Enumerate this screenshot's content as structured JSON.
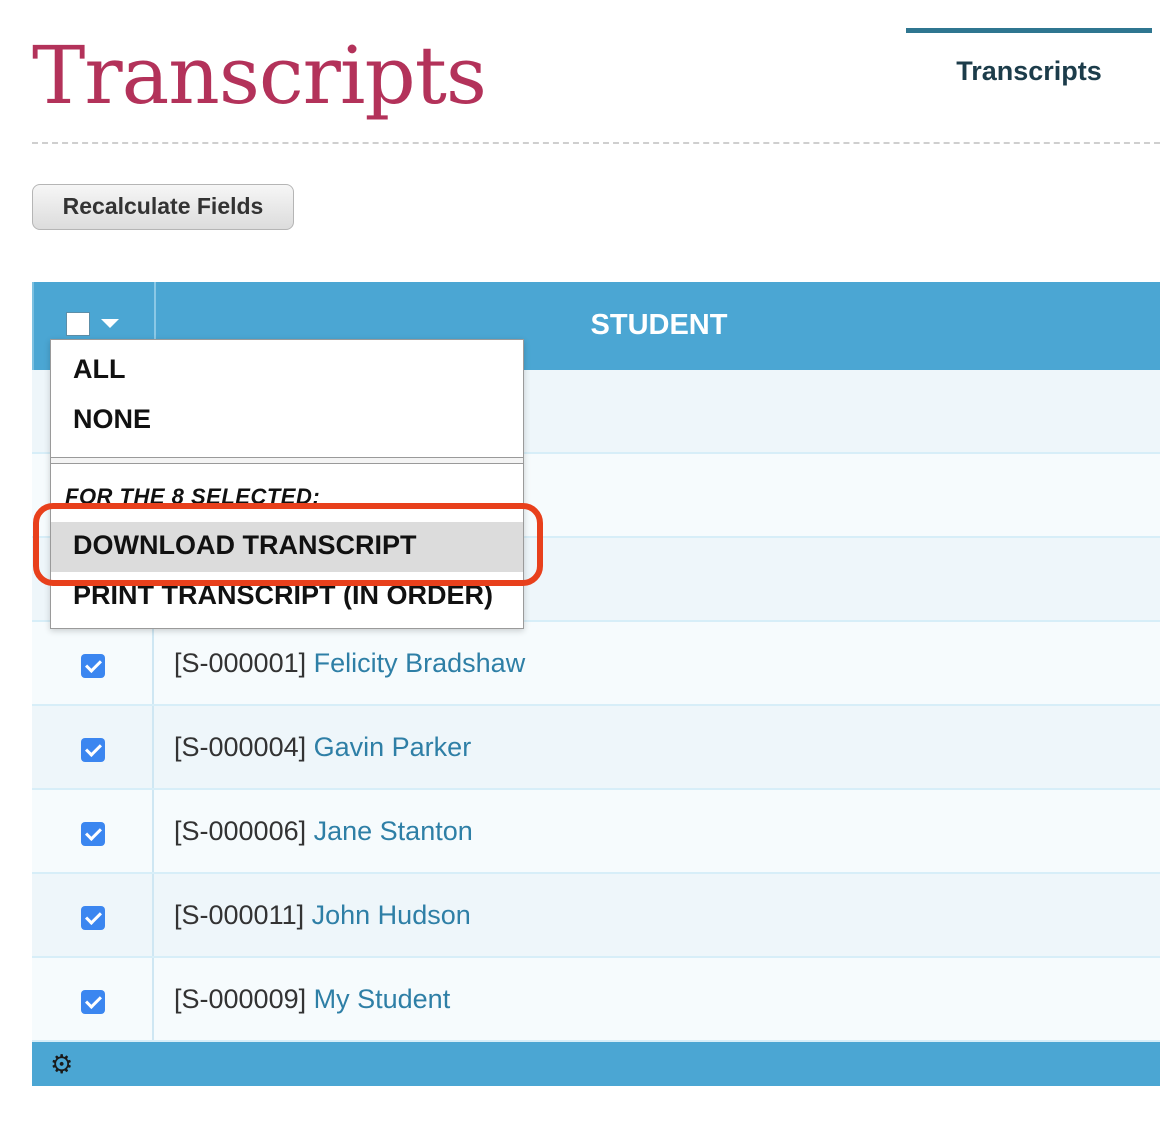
{
  "header": {
    "title": "Transcripts",
    "tab_label": "Transcripts"
  },
  "toolbar": {
    "recalculate_label": "Recalculate Fields"
  },
  "table": {
    "column_header": "STUDENT",
    "rows": [
      {
        "id": "[S-000001]",
        "name": "Felicity Bradshaw",
        "checked": true
      },
      {
        "id": "[S-000004]",
        "name": "Gavin Parker",
        "checked": true
      },
      {
        "id": "[S-000006]",
        "name": "Jane Stanton",
        "checked": true
      },
      {
        "id": "[S-000011]",
        "name": "John Hudson",
        "checked": true
      },
      {
        "id": "[S-000009]",
        "name": "My Student",
        "checked": true
      }
    ],
    "footer_icon": "gear-icon"
  },
  "dropdown": {
    "all_label": "ALL",
    "none_label": "NONE",
    "section_label": "FOR THE 8 SELECTED:",
    "download_label": "DOWNLOAD TRANSCRIPT",
    "print_label": "PRINT TRANSCRIPT (IN ORDER)"
  },
  "colors": {
    "title": "#b3325a",
    "table_header": "#4ba6d3",
    "link": "#2e7fa6",
    "highlight_ring": "#e8401c"
  }
}
